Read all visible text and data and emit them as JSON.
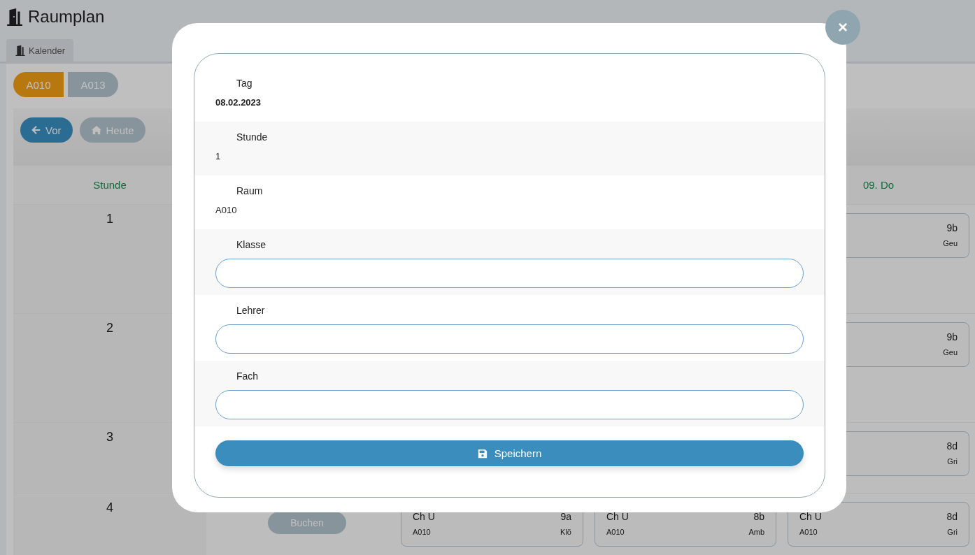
{
  "app": {
    "title": "Raumplan"
  },
  "tabs": [
    {
      "label": "Kalender",
      "selected": true
    }
  ],
  "rooms": [
    {
      "label": "A010",
      "selected": true
    },
    {
      "label": "A013",
      "selected": false
    }
  ],
  "nav": [
    {
      "label": "Vor",
      "kind": "back"
    },
    {
      "label": "Heute",
      "kind": "home"
    }
  ],
  "table": {
    "columns": [
      {
        "label": "Stunde"
      },
      {},
      {},
      {},
      {
        "label": "09. Do"
      }
    ],
    "rows": [
      {
        "hour": "1",
        "cells": [
          null,
          null,
          null,
          {
            "class": "9b",
            "teacher": "Geu"
          }
        ]
      },
      {
        "hour": "2",
        "cells": [
          null,
          null,
          null,
          {
            "class": "9b",
            "teacher": "Geu"
          }
        ]
      },
      {
        "hour": "3",
        "cells": [
          null,
          null,
          null,
          {
            "class": "8d",
            "teacher": "Gri"
          }
        ]
      },
      {
        "hour": "4",
        "cells": [
          {
            "kind": "book",
            "label": "Buchen"
          },
          {
            "subject": "Ch U",
            "class": "9a",
            "room": "A010",
            "teacher": "Klö"
          },
          {
            "subject": "Ch U",
            "class": "8b",
            "room": "A010",
            "teacher": "Amb"
          },
          {
            "subject": "Ch U",
            "class": "8d",
            "room": "A010",
            "teacher": "Gri"
          }
        ]
      }
    ]
  },
  "dialog": {
    "fields": [
      {
        "label": "Tag",
        "kind": "text",
        "value": "08.02.2023",
        "bold": true
      },
      {
        "label": "Stunde",
        "kind": "text",
        "value": "1",
        "bold": false
      },
      {
        "label": "Raum",
        "kind": "text",
        "value": "A010",
        "bold": false
      },
      {
        "label": "Klasse",
        "kind": "input"
      },
      {
        "label": "Lehrer",
        "kind": "input"
      },
      {
        "label": "Fach",
        "kind": "input"
      }
    ],
    "save": "Speichern",
    "close": "×"
  }
}
